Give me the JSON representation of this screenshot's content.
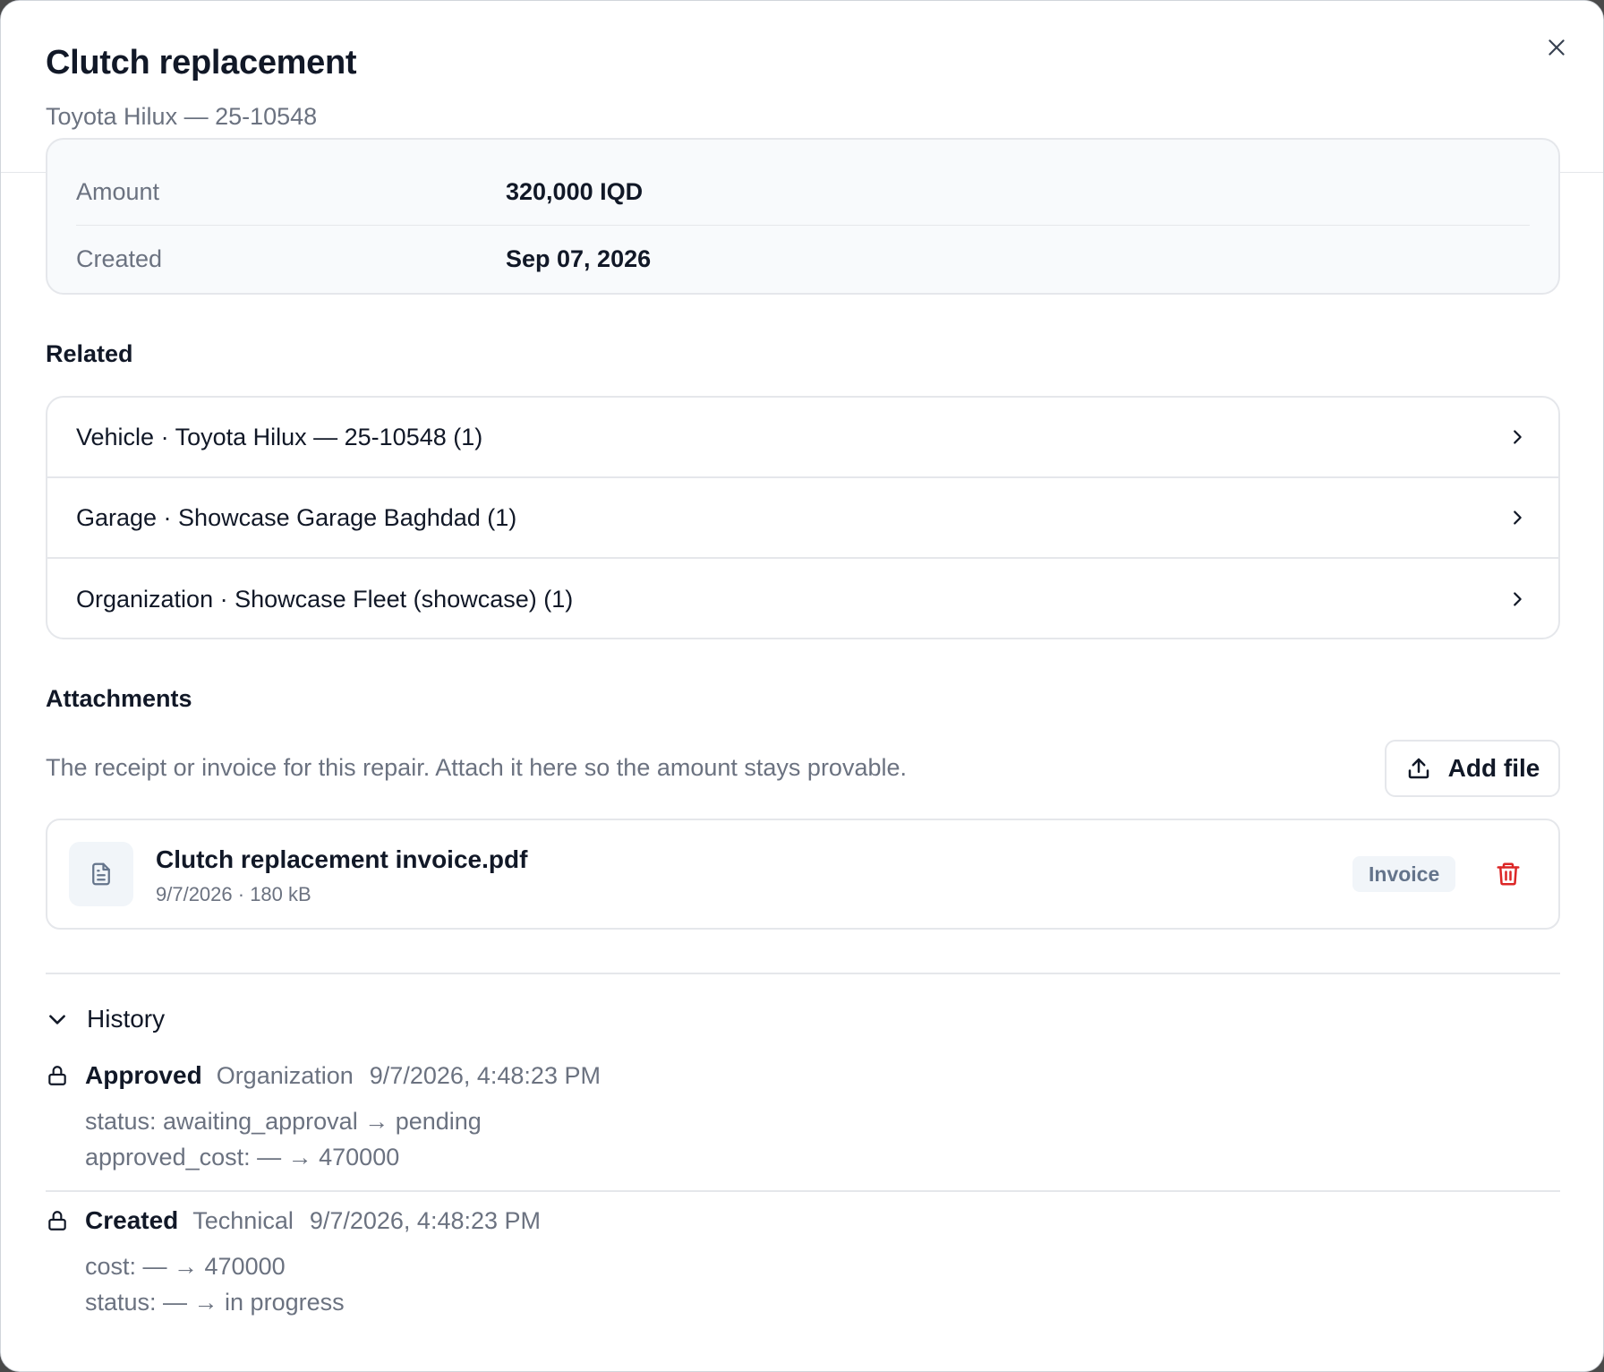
{
  "header": {
    "title": "Clutch replacement",
    "subtitle": "Toyota Hilux — 25-10548"
  },
  "details": {
    "amount_label": "Amount",
    "amount_value": "320,000 IQD",
    "created_label": "Created",
    "created_value": "Sep 07, 2026"
  },
  "related": {
    "title": "Related",
    "items": [
      {
        "label": "Vehicle · Toyota Hilux — 25-10548 (1)"
      },
      {
        "label": "Garage · Showcase Garage Baghdad (1)"
      },
      {
        "label": "Organization · Showcase Fleet (showcase) (1)"
      }
    ]
  },
  "attachments": {
    "title": "Attachments",
    "description": "The receipt or invoice for this repair. Attach it here so the amount stays provable.",
    "add_file_label": "Add file",
    "files": [
      {
        "name": "Clutch replacement invoice.pdf",
        "meta": "9/7/2026 · 180 kB",
        "badge": "Invoice"
      }
    ]
  },
  "history": {
    "title": "History",
    "entries": [
      {
        "action": "Approved",
        "actor": "Organization",
        "time": "9/7/2026, 4:48:23 PM",
        "changes": [
          "status: awaiting_approval → pending",
          "approved_cost: — → 470000"
        ]
      },
      {
        "action": "Created",
        "actor": "Technical",
        "time": "9/7/2026, 4:48:23 PM",
        "changes": [
          "cost: — → 470000",
          "status: — → in progress"
        ]
      }
    ]
  },
  "colors": {
    "danger": "#dc2626",
    "muted_text": "#6b7280",
    "border": "#e5e7eb"
  }
}
